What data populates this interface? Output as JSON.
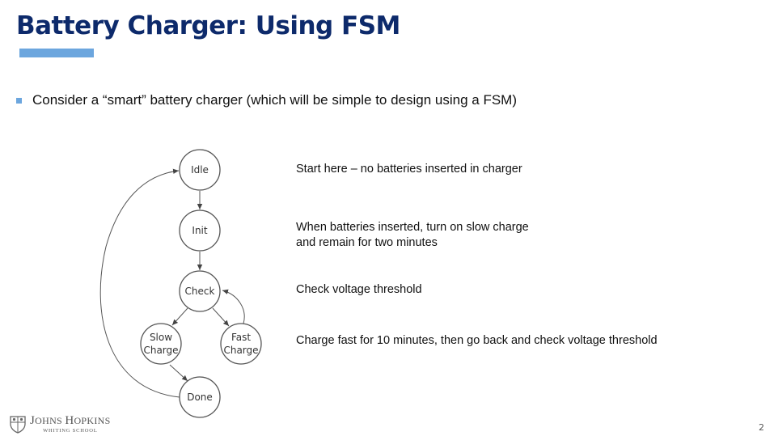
{
  "slide": {
    "title": "Battery Charger: Using FSM",
    "bullet": "Consider a “smart” battery charger (which will be simple to design using a FSM)",
    "page_number": "2"
  },
  "diagram": {
    "states": {
      "idle": [
        "Idle"
      ],
      "init": [
        "Init"
      ],
      "check": [
        "Check"
      ],
      "slow_charge": [
        "Slow",
        "Charge"
      ],
      "fast_charge": [
        "Fast",
        "Charge"
      ],
      "done": [
        "Done"
      ]
    },
    "transitions": [
      [
        "Idle",
        "Init"
      ],
      [
        "Init",
        "Check"
      ],
      [
        "Check",
        "Slow Charge"
      ],
      [
        "Check",
        "Fast Charge"
      ],
      [
        "Fast Charge",
        "Check"
      ],
      [
        "Slow Charge",
        "Done"
      ],
      [
        "Done",
        "Idle"
      ]
    ]
  },
  "notes": {
    "idle": "Start here – no batteries inserted in charger",
    "init_line1": "When batteries inserted, turn on slow charge",
    "init_line2": "and remain for two minutes",
    "check": "Check voltage threshold",
    "fast": "Charge fast for 10 minutes, then go back and check voltage threshold"
  },
  "logo": {
    "name_initial_1": "J",
    "name_part_1": "OHNS ",
    "name_initial_2": "H",
    "name_part_2": "OPKINS",
    "subtitle": "WHITING SCHOOL"
  },
  "colors": {
    "title": "#0d2a6b",
    "accent": "#6ca6de"
  }
}
